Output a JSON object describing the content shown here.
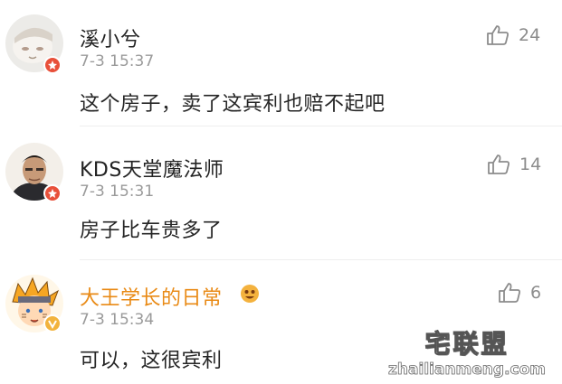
{
  "comments": [
    {
      "username": "溪小兮",
      "time": "7-3 15:37",
      "text": "这个房子，卖了这宾利也赔不起吧",
      "likes": "24",
      "avatar": "avatar-cartoon-face",
      "badge_color": "#e8503a"
    },
    {
      "username": "KDS天堂魔法师",
      "time": "7-3 15:31",
      "text": "房子比车贵多了",
      "likes": "14",
      "avatar": "avatar-man-photo",
      "badge_color": "#e8503a"
    },
    {
      "username": "大王学长的日常",
      "time": "7-3 15:34",
      "text": "可以，这很宾利",
      "likes": "6",
      "avatar": "avatar-naruto",
      "badge_color": "#f2b33d",
      "name_color": "#e98a15"
    }
  ],
  "watermark": {
    "logo": "宅联盟",
    "url": "zhailianmeng.com"
  },
  "icons": {
    "like": "thumbs-up-icon",
    "verified": "verified-badge-icon",
    "medal": "fan-medal-icon"
  }
}
